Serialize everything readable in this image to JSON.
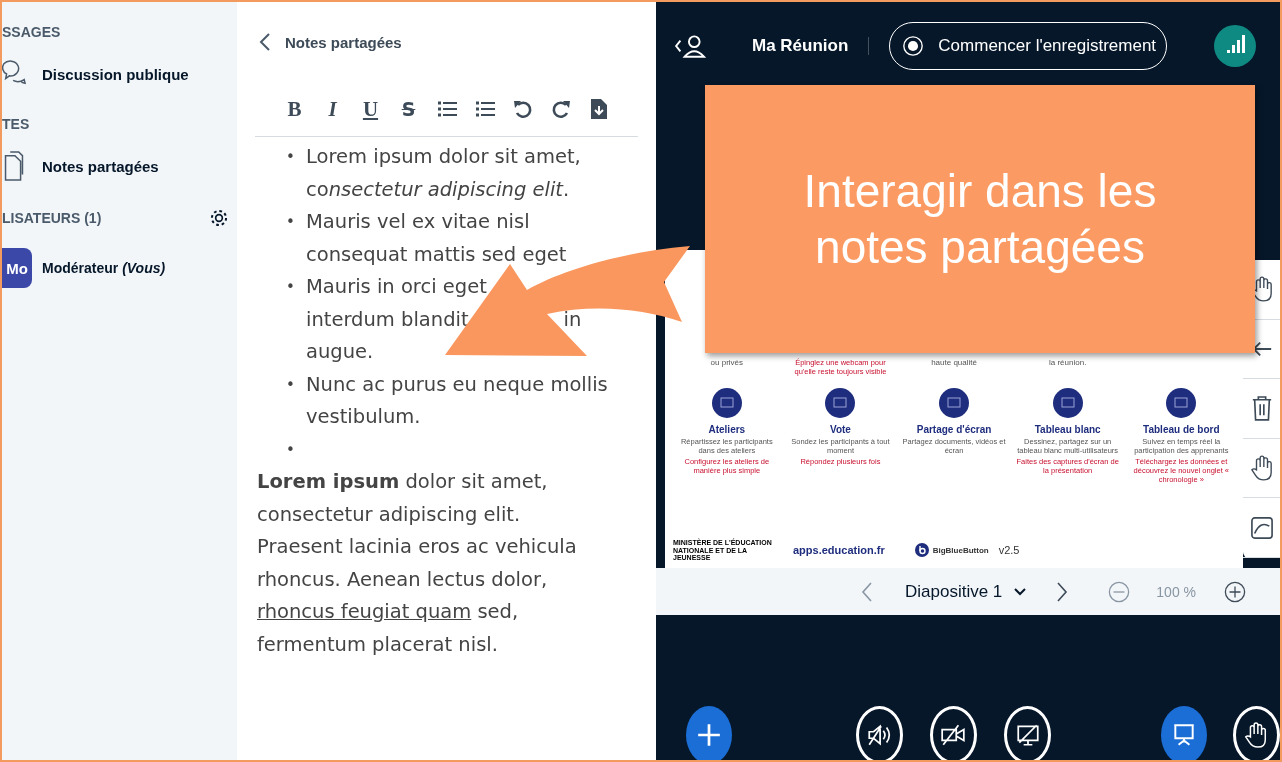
{
  "sidebar": {
    "sections": [
      {
        "heading": "SSAGES",
        "items": [
          {
            "label": "Discussion publique"
          }
        ]
      },
      {
        "heading": "TES",
        "items": [
          {
            "label": "Notes partagées"
          }
        ]
      }
    ],
    "users": {
      "heading": "LISATEURS (1)",
      "list": [
        {
          "initials": "Mo",
          "name": "Modérateur *(Vous)*"
        }
      ]
    }
  },
  "notes": {
    "title": "Notes partagées",
    "toolbar": [
      {
        "kind": "bold",
        "label": "B"
      },
      {
        "kind": "italic",
        "label": "I"
      },
      {
        "kind": "underline",
        "label": "U"
      },
      {
        "kind": "strike",
        "label": "S"
      },
      {
        "kind": "ordered"
      },
      {
        "kind": "bullets"
      },
      {
        "kind": "undo"
      },
      {
        "kind": "redo"
      },
      {
        "kind": "export"
      }
    ],
    "bullets": [
      {
        "marker": "•",
        "lines": [
          {
            "text": "Lorem ipsum dolor sit amet,"
          },
          {
            "text": "co",
            "italic": "nsectetur adipiscing elit",
            "tail": "."
          }
        ]
      },
      {
        "marker": "•",
        "lines": [
          {
            "text": "Mauris vel ex vitae nisl"
          },
          {
            "text": "consequat mattis sed eget"
          }
        ]
      },
      {
        "marker": "•",
        "lines": [
          {
            "text": "Mauris in orci eget"
          },
          {
            "text": "interdum blandit",
            "after_gap": "in"
          },
          {
            "text": "augue."
          }
        ]
      },
      {
        "marker": "•",
        "lines": [
          {
            "text": "Nunc ac purus eu neque mollis"
          },
          {
            "text": "vestibulum."
          }
        ]
      },
      {
        "marker": "•"
      }
    ],
    "paragraph": {
      "before": "**Lorem ipsum** dolor sit amet, consectetur adipiscing elit. Praesent lacinia eros ac vehicula rhoncus. Aenean lectus dolor, ",
      "underlined": "rhoncus feugiat quam",
      "after": " sed, fermentum placerat nisl."
    }
  },
  "header": {
    "meeting": "Ma Réunion",
    "record": "Commencer l'enregistrement"
  },
  "slide": {
    "top_notes": [
      {
        "grey": "ou privés"
      },
      {
        "red": "Épinglez une webcam pour qu'elle reste toujours visible"
      },
      {
        "grey": "haute qualité"
      },
      {
        "grey": "la réunion."
      }
    ],
    "features": [
      {
        "title": "Ateliers",
        "text": "Répartissez les participants dans des ateliers",
        "note": "Configurez les ateliers de manière plus simple"
      },
      {
        "title": "Vote",
        "text": "Sondez les participants à tout moment",
        "note": "Répondez plusieurs fois"
      },
      {
        "title": "Partage d'écran",
        "text": "Partagez documents, vidéos et écran"
      },
      {
        "title": "Tableau blanc",
        "text": "Dessinez, partagez sur un tableau blanc multi-utilisateurs",
        "note": "Faites des captures d'écran de la présentation"
      },
      {
        "title": "Tableau de bord",
        "text": "Suivez en temps réel la participation des apprenants",
        "note": "Téléchargez les données et découvrez le nouvel onglet « chronologie »"
      }
    ],
    "ministry": "MINISTÈRE DE L'ÉDUCATION NATIONALE ET DE LA JEUNESSE",
    "apps": "apps.education.fr",
    "bbb": "BigBlueButton",
    "version": "v2.5"
  },
  "tools": [
    {
      "kind": "hand"
    },
    {
      "kind": "arrow"
    },
    {
      "kind": "trash"
    },
    {
      "kind": "hand"
    },
    {
      "kind": "chart"
    }
  ],
  "slide_nav": {
    "label": "Diapositive 1",
    "zoom": "100 %"
  },
  "actions": [
    {
      "kind": "plus"
    },
    {
      "kind": "audio"
    },
    {
      "kind": "video"
    },
    {
      "kind": "screen"
    },
    {
      "kind": "presentation"
    },
    {
      "kind": "hand"
    }
  ],
  "callout": {
    "text": "Interagir dans les notes partagées"
  }
}
